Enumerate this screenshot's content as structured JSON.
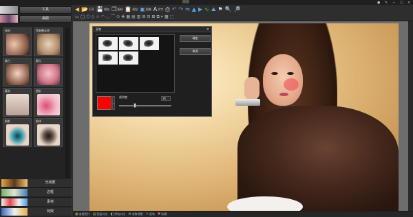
{
  "window": {
    "title": "画图",
    "controls": [
      "●",
      "✎",
      "−",
      "□",
      "✕"
    ]
  },
  "left_panel": {
    "tabs": [
      {
        "label": "工具"
      },
      {
        "label": "美颜"
      }
    ],
    "grid_items": [
      {
        "label": "祛斑"
      },
      {
        "label": "黑眼圈去除"
      },
      {
        "label": "美白"
      },
      {
        "label": "腮红"
      },
      {
        "label": "睫毛"
      },
      {
        "label": "唇彩"
      },
      {
        "label": "眼影"
      },
      {
        "label": "眼线"
      }
    ],
    "bottom_tabs": [
      {
        "label": "光线照"
      },
      {
        "label": "边框"
      },
      {
        "label": "素材"
      },
      {
        "label": "特效"
      }
    ]
  },
  "toolbar": {
    "row1": [
      {
        "icon": "arrow-left-icon",
        "glyph": "◀"
      },
      {
        "icon": "folder-open-icon",
        "glyph": "📂",
        "label": "打开"
      },
      {
        "icon": "save-icon",
        "glyph": "💾",
        "label": "保存"
      },
      {
        "icon": "copy-icon",
        "glyph": "❐",
        "label": "复制"
      },
      {
        "icon": "paste-icon",
        "glyph": "📋",
        "label": "粘贴"
      },
      {
        "icon": "image-icon",
        "glyph": "▣",
        "label": "图像"
      },
      {
        "icon": "text-icon",
        "glyph": "A",
        "label": "文字"
      },
      {
        "icon": "print-icon",
        "glyph": "⎙"
      },
      {
        "icon": "undo-icon",
        "glyph": "↶"
      },
      {
        "icon": "redo-icon",
        "glyph": "↷"
      },
      {
        "icon": "flip-icon",
        "glyph": "⇋"
      },
      {
        "icon": "triangle-icon",
        "glyph": "▲"
      },
      {
        "icon": "chevron-right-icon",
        "glyph": "▶"
      },
      {
        "icon": "curve-icon",
        "glyph": "∿"
      },
      {
        "icon": "mountain-icon",
        "glyph": "⛰"
      },
      {
        "icon": "bookmark-icon",
        "glyph": "⚑"
      },
      {
        "icon": "zoom-in-icon",
        "glyph": "🔍"
      },
      {
        "icon": "zoom-out-icon",
        "glyph": "🔎"
      }
    ],
    "row2": [
      "▭",
      "◯",
      "⬡",
      "◇",
      "☆",
      "◠",
      "◡",
      "⌒",
      "⬭",
      "✚",
      "▦",
      "▤",
      "▥",
      "⊞",
      "⊟",
      "⊠",
      "⧉",
      "⌗",
      "▩",
      "⬚"
    ]
  },
  "dialog": {
    "title": "画笔",
    "confirm_label": "确定",
    "cancel_label": "取消",
    "opacity_label": "透明度",
    "opacity_value": "36",
    "opacity_fraction": 0.3,
    "color": "#ff0000"
  },
  "status_bar": [
    {
      "icon": "image-icon",
      "label": "查看图片"
    },
    {
      "icon": "layers-icon",
      "label": "图层对比"
    },
    {
      "icon": "compare-icon",
      "label": "原始对比"
    },
    {
      "icon": "settings-icon",
      "label": "参数调整"
    },
    {
      "icon": "brush-icon",
      "label": "画笔"
    },
    {
      "icon": "heart-icon",
      "label": "收藏"
    }
  ]
}
